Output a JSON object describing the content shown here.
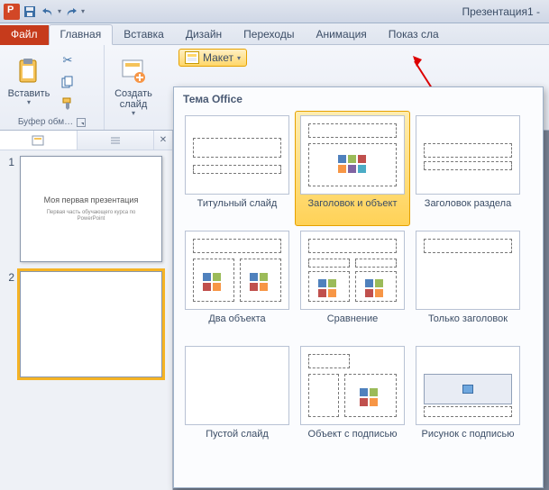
{
  "window": {
    "title": "Презентация1 -"
  },
  "tabs": {
    "file": "Файл",
    "home": "Главная",
    "insert": "Вставка",
    "design": "Дизайн",
    "transitions": "Переходы",
    "animation": "Анимация",
    "slideshow": "Показ сла"
  },
  "ribbon": {
    "clipboard": {
      "paste": "Вставить",
      "group": "Буфер обм…"
    },
    "slides": {
      "newSlide": "Создать\nслайд",
      "layout": "Макет"
    }
  },
  "gallery": {
    "header": "Тема Office",
    "items": [
      {
        "key": "title",
        "label": "Титульный слайд"
      },
      {
        "key": "titleContent",
        "label": "Заголовок и объект",
        "selected": true
      },
      {
        "key": "section",
        "label": "Заголовок раздела"
      },
      {
        "key": "twoContent",
        "label": "Два объекта"
      },
      {
        "key": "comparison",
        "label": "Сравнение"
      },
      {
        "key": "titleOnly",
        "label": "Только заголовок"
      },
      {
        "key": "blank",
        "label": "Пустой слайд"
      },
      {
        "key": "objCap",
        "label": "Объект с подписью"
      },
      {
        "key": "picCap",
        "label": "Рисунок с подписью"
      }
    ]
  },
  "slides": {
    "s1": {
      "num": "1",
      "title": "Моя первая презентация",
      "sub": "Первая часть обучающего курса по\nPowerPoint"
    },
    "s2": {
      "num": "2"
    }
  },
  "colors": {
    "accent": "#d24726",
    "highlight": "#ffd257"
  }
}
